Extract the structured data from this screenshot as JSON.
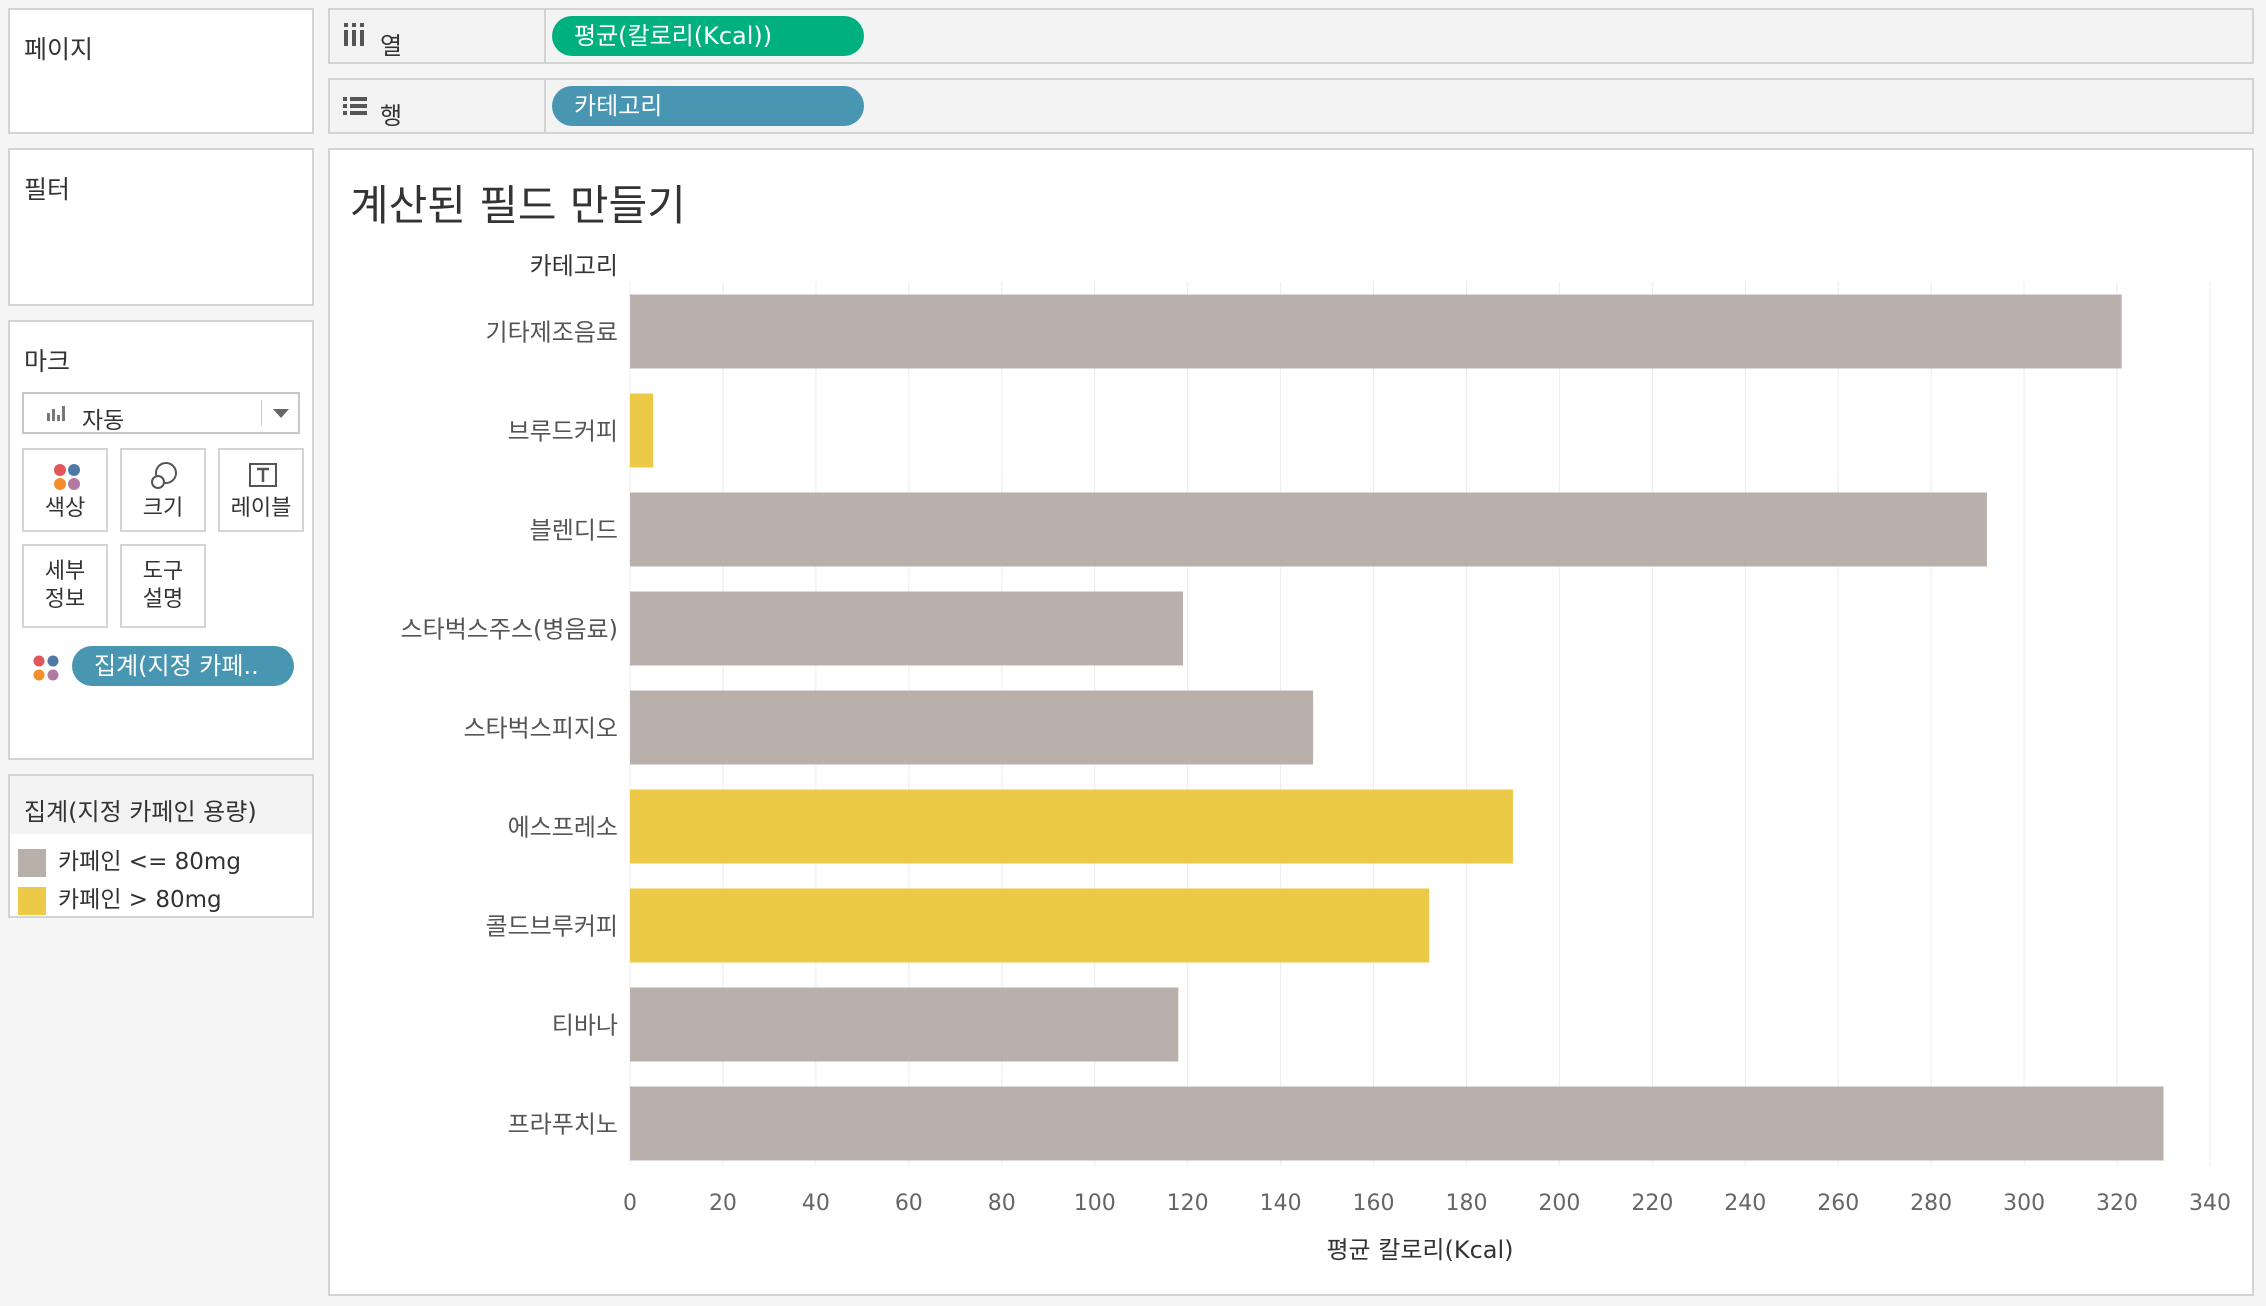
{
  "pages_panel": {
    "title": "페이지"
  },
  "filters_panel": {
    "title": "필터"
  },
  "marks_panel": {
    "title": "마크",
    "mark_type": "자동",
    "buttons": {
      "color": "색상",
      "size": "크기",
      "label": "레이블",
      "detail_1": "세부",
      "detail_2": "정보",
      "tooltip_1": "도구",
      "tooltip_2": "설명"
    },
    "color_pill": "집계(지정 카페.."
  },
  "legend_panel": {
    "title": "집계(지정 카페인 용량)",
    "items": [
      {
        "label": "카페인 <= 80mg",
        "color": "#bab0ab"
      },
      {
        "label": "카페인 > 80mg",
        "color": "#ecc947"
      }
    ]
  },
  "columns_shelf": {
    "label": "열",
    "pill": "평균(칼로리(Kcal))",
    "pill_color": "#00b07f"
  },
  "rows_shelf": {
    "label": "행",
    "pill": "카테고리",
    "pill_color": "#4996b2"
  },
  "chart_data": {
    "type": "bar",
    "orientation": "horizontal",
    "title": "계산된 필드 만들기",
    "row_header": "카테고리",
    "xlabel": "평균 칼로리(Kcal)",
    "xlim": [
      0,
      340
    ],
    "xticks": [
      0,
      20,
      40,
      60,
      80,
      100,
      120,
      140,
      160,
      180,
      200,
      220,
      240,
      260,
      280,
      300,
      320,
      340
    ],
    "grid": true,
    "categories": [
      "기타제조음료",
      "브루드커피",
      "블렌디드",
      "스타벅스주스(병음료)",
      "스타벅스피지오",
      "에스프레소",
      "콜드브루커피",
      "티바나",
      "프라푸치노"
    ],
    "values": [
      321,
      5,
      292,
      119,
      147,
      190,
      172,
      118,
      330
    ],
    "color_group": [
      "카페인 <= 80mg",
      "카페인 > 80mg",
      "카페인 <= 80mg",
      "카페인 <= 80mg",
      "카페인 <= 80mg",
      "카페인 > 80mg",
      "카페인 > 80mg",
      "카페인 <= 80mg",
      "카페인 <= 80mg"
    ],
    "colors": {
      "low": "#bab0ab",
      "high": "#ecc947"
    }
  }
}
